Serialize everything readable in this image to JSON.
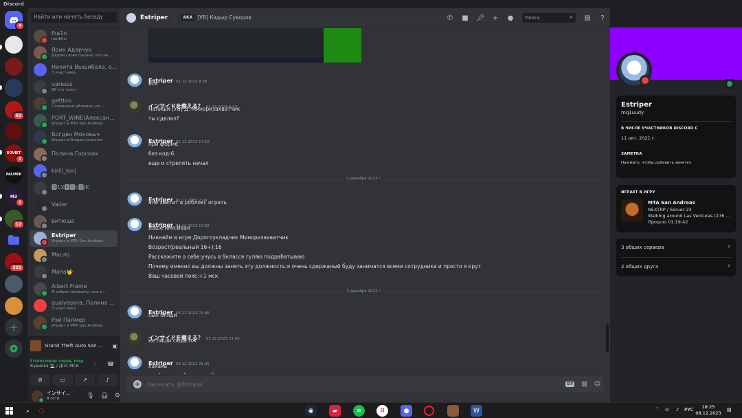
{
  "app": {
    "title": "Discord"
  },
  "servers": [
    {
      "badge": "4"
    },
    {
      "badge": ""
    },
    {
      "badge": ""
    },
    {
      "badge": ""
    },
    {
      "badge": "62"
    },
    {
      "badge": ""
    },
    {
      "badge": "1",
      "label": "SOVIET"
    },
    {
      "badge": "",
      "label": "PALMER"
    },
    {
      "badge": "1",
      "label": "M3"
    },
    {
      "badge": "12"
    },
    {
      "badge": ""
    },
    {
      "badge": "321"
    },
    {
      "badge": ""
    },
    {
      "badge": ""
    }
  ],
  "dm_search": {
    "placeholder": "Найти или начать беседу"
  },
  "dms": [
    {
      "name": "Fra1n",
      "sub": "hardline",
      "color": "#5b4b3f",
      "status": "#f23f43"
    },
    {
      "name": "Ярик Адарчук",
      "sub": "Дядим слово пацана, что не ...",
      "color": "#7a5a4a",
      "status": "#23a55a"
    },
    {
      "name": "Никита Вышибала, q...",
      "sub": "3 участника",
      "color": "#5865f2",
      "status": ""
    },
    {
      "name": "uaresss",
      "sub": "66 это тильт",
      "color": "#3b3e44",
      "status": "#80848e"
    },
    {
      "name": "getttoo",
      "sub": "Сломанный ублюдок, ро...",
      "color": "#4a3f35",
      "status": "#23a55a"
    },
    {
      "name": "PORT_WINE(Алексан...",
      "sub": "Играет в MTA San Andreas",
      "color": "#3c5a4c",
      "status": "#23a55a"
    },
    {
      "name": "Богдан Моковыч",
      "sub": "Играет в Dragon Launcher",
      "color": "#2f3a4a",
      "status": "#23a55a"
    },
    {
      "name": "Полина Горских",
      "sub": "",
      "color": "#8a6a52",
      "status": "#80848e"
    },
    {
      "name": "kirill_korj",
      "sub": "",
      "color": "#5865f2",
      "status": "#80848e"
    },
    {
      "name": "🅾1X🅾🅾c🅾jK",
      "sub": "",
      "color": "#3a3c40",
      "status": "#80848e"
    },
    {
      "name": "Vader",
      "sub": "",
      "color": "#2a2a2a",
      "status": "#80848e"
    },
    {
      "name": "витюша",
      "sub": "",
      "color": "#6a5a52",
      "status": "#80848e"
    },
    {
      "name": "Estriper",
      "sub": "Играет в MTA San Andreas",
      "color": "#9ab4d8",
      "status": "#f23f43"
    },
    {
      "name": "Масло",
      "sub": "",
      "color": "#c89a5a",
      "status": "#80848e"
    },
    {
      "name": "Maha🤟",
      "sub": "",
      "color": "#3c3c3c",
      "status": "#80848e"
    },
    {
      "name": "Albert Frame",
      "sub": "Я забрал малышку, она в ...",
      "color": "#4a4a4a",
      "status": "#23a55a"
    },
    {
      "name": "qualyapora, Полина Г...",
      "sub": "3 участника",
      "color": "#f23f43",
      "status": ""
    },
    {
      "name": "Рэй Палмер",
      "sub": "Играет в MTA San Andreas",
      "color": "#5a4030",
      "status": "#23a55a"
    }
  ],
  "activity": {
    "game": "Grand Theft Auto San ...",
    "voice_title": "Голосовая связь под",
    "voice_sub": "Курилка 🚬 / ДПС МСК"
  },
  "me": {
    "name": "インサイ...",
    "status": "В сети"
  },
  "header": {
    "name": "Estriper",
    "aka": "AKA",
    "alias": "[УВ] Кадыр Суворов",
    "search_placeholder": "Поиск"
  },
  "messages": [
    {
      "author": "Estriper",
      "time": "01.12.2023 9:38",
      "avatar": "est",
      "lines": [
        "все"
      ]
    },
    {
      "author": "インサイドを察える？",
      "time": "01.12.2023 9:43",
      "avatar": "inz",
      "lines": [
        "Напиши [УВ] Д. Миноризахватчик",
        "ты сделал?"
      ]
    },
    {
      "author": "Estriper",
      "time": "01.12.2023 17:16",
      "avatar": "est",
      "lines": [
        "при форме",
        "без код-6",
        "еще и стрелять начал"
      ]
    },
    {
      "divider": "2 декабря 2023 г."
    },
    {
      "author": "Estriper",
      "time": "02.12.2023 2:00",
      "avatar": "est",
      "lines": [
        "але хватит в роблокс играть"
      ]
    },
    {
      "author": "Estriper",
      "time": "02.12.2023 17:55",
      "avatar": "est",
      "lines": [
        "Ваше имя:Иван",
        "Никнейм в игре:Дорогоукладчик Миноризахватчик",
        "Возраст(реальный 16+):16",
        "Расскажите о себе:учусь в 9классе гуляю подрабатываю",
        "Почему именно вы должны занять эту должность:я очень сдержаный буду заниматся всеми сотрудника и просто я крут",
        "Ваш часовой пояс:+1 мск"
      ]
    },
    {
      "divider": "3 декабря 2023 г."
    },
    {
      "author": "Estriper",
      "time": "03.12.2023 21:45",
      "avatar": "est",
      "lines": [
        "сын бляди"
      ]
    },
    {
      "author": "インサイドを察える？",
      "time": "03.12.2023 21:45",
      "avatar": "inz",
      "lines": [
        "не пиши сюда пж"
      ]
    },
    {
      "author": "Estriper",
      "time": "03.12.2023 21:45",
      "avatar": "est",
      "lines": [
        "хахаха",
        "окей попуск бомжу не буду"
      ]
    }
  ],
  "composer": {
    "placeholder": "Написать @Estriper",
    "gif": "GIF"
  },
  "profile": {
    "display_name": "Estriper",
    "username": "mq1uudy",
    "member_label": "В ЧИСЛЕ УЧАСТНИКОВ DISCORD С",
    "member_since": "11 окт. 2021 г.",
    "note_label": "ЗАМЕТКА",
    "note_placeholder": "Нажмите, чтобы добавить заметку",
    "playing_label": "ИГРАЕТ В ИГРУ",
    "game_name": "MTA San Andreas",
    "game_line2": "NEXTRP / Server 23",
    "game_line3": "Walking around Las Venturas (276 ...",
    "game_elapsed": "Прошло 01:19:42",
    "mutual_servers": "3 общих сервера",
    "mutual_friends": "2 общих друга"
  },
  "taskbar": {
    "lang": "РУС",
    "time": "18:25",
    "date": "08.12.2023"
  }
}
